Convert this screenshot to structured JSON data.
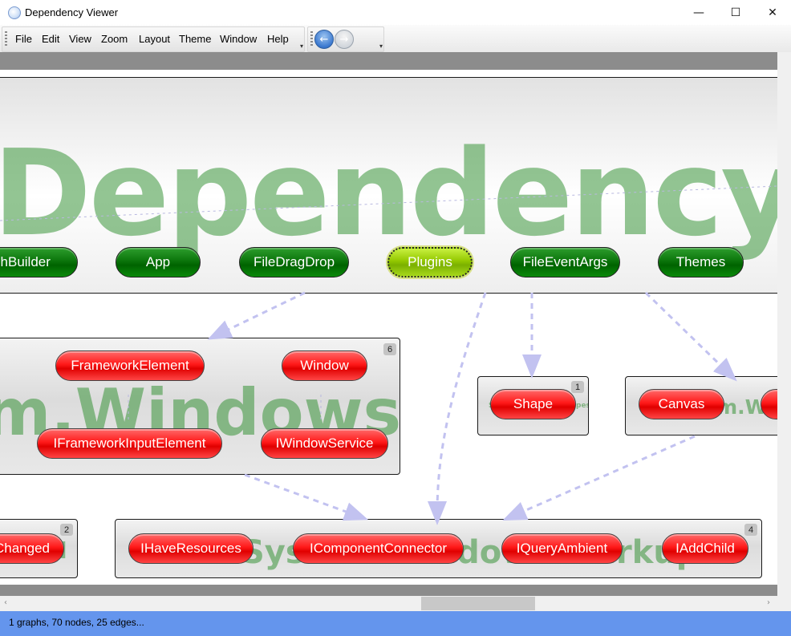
{
  "window": {
    "title": "Dependency Viewer",
    "minimize": "—",
    "maximize": "☐",
    "close": "✕"
  },
  "menu": [
    "File",
    "Edit",
    "View",
    "Zoom",
    "Layout",
    "Theme",
    "Window",
    "Help"
  ],
  "nav": {
    "back": "←",
    "forward": "→"
  },
  "groups": [
    {
      "id": "top",
      "watermark": "DependencyV",
      "nodes": [
        "phBuilder",
        "App",
        "FileDragDrop",
        "Plugins",
        "FileEventArgs",
        "Themes"
      ],
      "selected": "Plugins"
    },
    {
      "id": "windows",
      "watermark": "m.Windows",
      "count": "6",
      "nodes": [
        "FrameworkElement",
        "Window",
        "IFrameworkInputElement",
        "IWindowService"
      ]
    },
    {
      "id": "shapes",
      "watermark": "System.Windows.Shapes",
      "count": "1",
      "nodes": [
        "Shape"
      ]
    },
    {
      "id": "controls",
      "watermark": "System.Wind",
      "nodes": [
        "Canvas"
      ]
    },
    {
      "id": "left",
      "watermark": "del",
      "count": "2",
      "nodes": [
        "Changed"
      ]
    },
    {
      "id": "markup",
      "watermark": "System.Windows.Markup",
      "count": "4",
      "nodes": [
        "IHaveResources",
        "IComponentConnector",
        "IQueryAmbient",
        "IAddChild"
      ]
    }
  ],
  "status": "1 graphs, 70 nodes, 25 edges...",
  "colors": {
    "status_bar": "#6495ed",
    "node_red": "#ff2020",
    "node_green": "#0a7a0a",
    "node_selected": "#93c800",
    "edge": "#c0c0f0"
  }
}
